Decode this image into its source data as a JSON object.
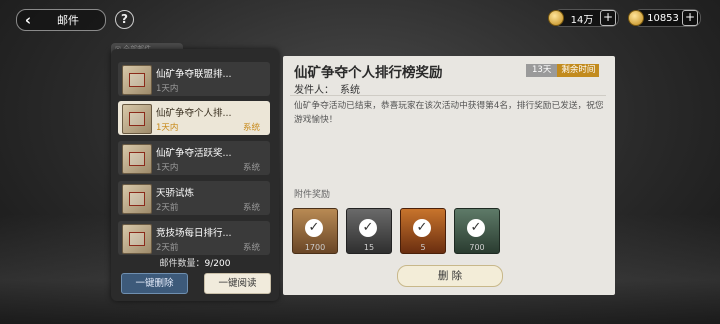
{
  "header": {
    "title": "邮件",
    "help_label": "?"
  },
  "resources": [
    {
      "value": "14万",
      "icon": "coin-icon"
    },
    {
      "value": "10853",
      "icon": "gem-icon"
    }
  ],
  "mail_list": {
    "items": [
      {
        "title": "仙矿争夺联盟排...",
        "date": "1天内",
        "sender": ""
      },
      {
        "title": "仙矿争夺个人排...",
        "date": "1天内",
        "sender": "系统",
        "selected": true
      },
      {
        "title": "仙矿争夺活跃奖...",
        "date": "1天内",
        "sender": "系统"
      },
      {
        "title": "天骄试炼",
        "date": "2天前",
        "sender": "系统"
      },
      {
        "title": "竞技场每日排行...",
        "date": "2天前",
        "sender": "系统"
      }
    ],
    "count_label": "邮件数量：",
    "count_value": "9/200",
    "delete_all_label": "一键删除",
    "read_all_label": "一键阅读"
  },
  "detail": {
    "title": "仙矿争夺个人排行榜奖励",
    "expire_days": "13天",
    "expire_label": "剩余时间",
    "sender_label": "发件人：",
    "sender_value": "系统",
    "body": "仙矿争夺活动已结束，恭喜玩家在该次活动中获得第4名，排行奖励已发送，祝您游戏愉快！",
    "attachments_label": "附件奖励",
    "rewards": [
      {
        "count": "1700"
      },
      {
        "count": "15"
      },
      {
        "count": "5"
      },
      {
        "count": "700"
      }
    ],
    "delete_label": "删 除"
  },
  "colors": {
    "accent": "#c28b1e",
    "selected_bg": "#ece6d7",
    "primary_button": "#3d5a7a"
  }
}
